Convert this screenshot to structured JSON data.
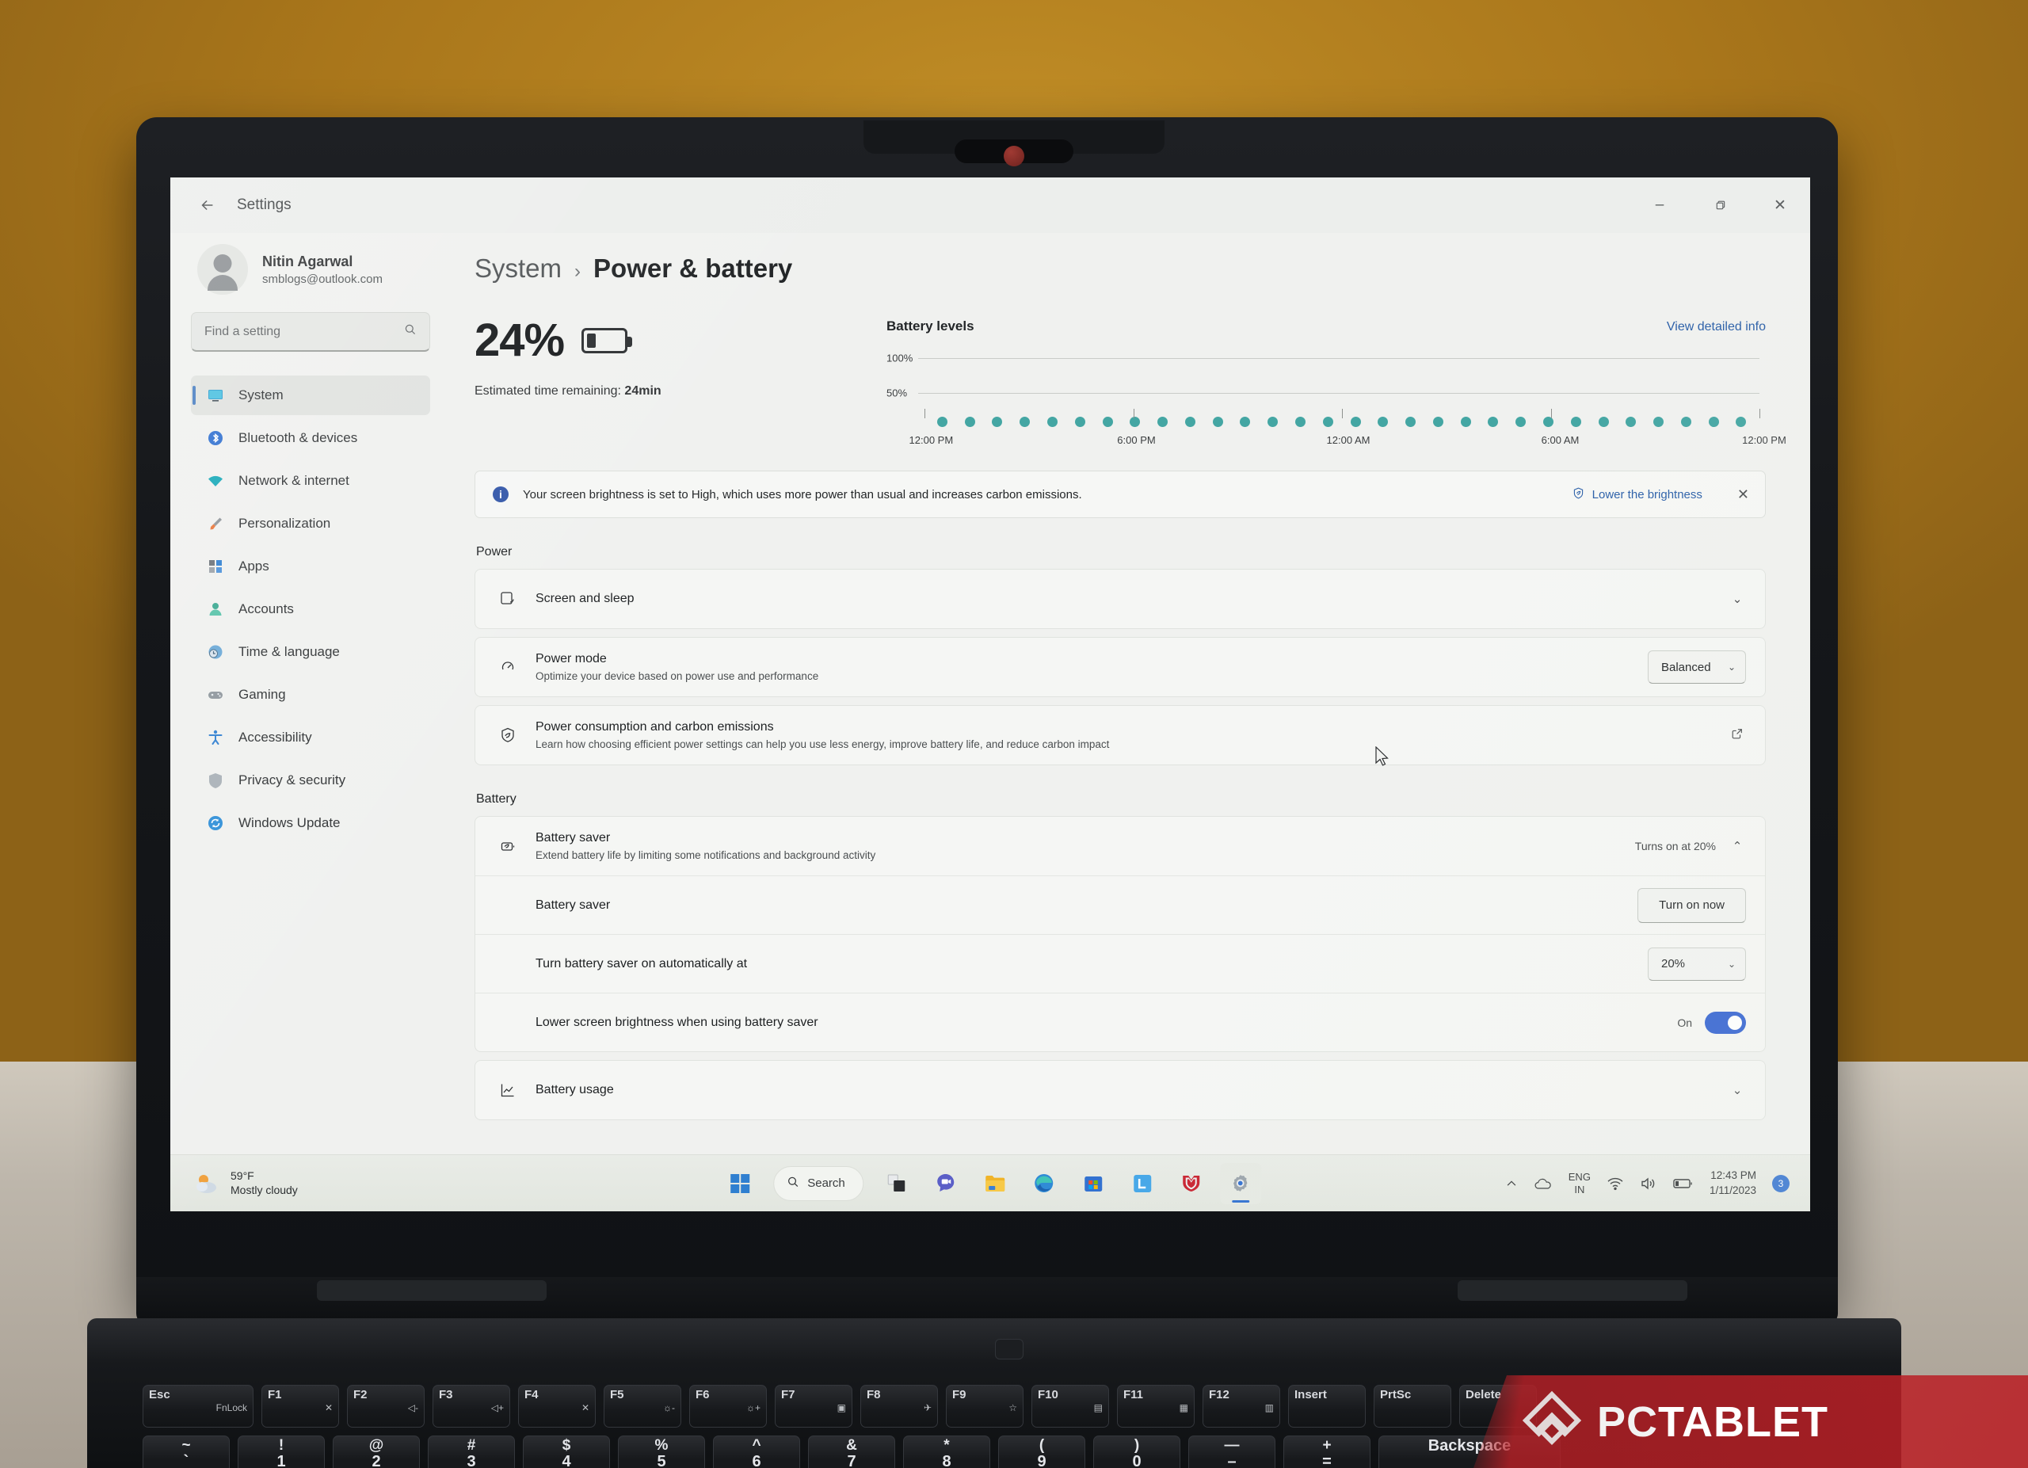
{
  "window": {
    "title": "Settings",
    "back_icon": "back-arrow-icon",
    "minimize": "–",
    "maximize": "❐",
    "close": "✕"
  },
  "account": {
    "name": "Nitin Agarwal",
    "email": "smblogs@outlook.com"
  },
  "search": {
    "placeholder": "Find a setting",
    "icon": "search-icon"
  },
  "sidebar": {
    "items": [
      {
        "label": "System",
        "icon": "monitor-icon",
        "active": true
      },
      {
        "label": "Bluetooth & devices",
        "icon": "bluetooth-icon",
        "active": false
      },
      {
        "label": "Network & internet",
        "icon": "wifi-icon",
        "active": false
      },
      {
        "label": "Personalization",
        "icon": "paintbrush-icon",
        "active": false
      },
      {
        "label": "Apps",
        "icon": "apps-grid-icon",
        "active": false
      },
      {
        "label": "Accounts",
        "icon": "person-icon",
        "active": false
      },
      {
        "label": "Time & language",
        "icon": "clock-globe-icon",
        "active": false
      },
      {
        "label": "Gaming",
        "icon": "gamepad-icon",
        "active": false
      },
      {
        "label": "Accessibility",
        "icon": "accessibility-icon",
        "active": false
      },
      {
        "label": "Privacy & security",
        "icon": "shield-icon",
        "active": false
      },
      {
        "label": "Windows Update",
        "icon": "update-refresh-icon",
        "active": false
      }
    ]
  },
  "breadcrumb": {
    "root": "System",
    "separator": "›",
    "leaf": "Power & battery"
  },
  "battery_summary": {
    "percent": "24%",
    "estimated_label": "Estimated time remaining:",
    "estimated_value": "24min",
    "battery_icon": "battery-low-icon"
  },
  "chart_data": {
    "type": "scatter",
    "title": "Battery levels",
    "link_label": "View detailed info",
    "xlabel": "",
    "ylabel": "",
    "ylim": [
      0,
      100
    ],
    "ytick_labels": [
      "100%",
      "50%"
    ],
    "yticks": [
      100,
      50
    ],
    "grid": true,
    "x_tick_labels": [
      "12:00 PM",
      "6:00 PM",
      "12:00 AM",
      "6:00 AM",
      "12:00 PM"
    ],
    "x_tick_positions": [
      0,
      25,
      50,
      75,
      100
    ],
    "series": [
      {
        "name": "Battery level",
        "color": "#44a6a3",
        "x": [
          1.5,
          4.8,
          8.1,
          11.4,
          14.7,
          18.0,
          21.3,
          24.6,
          27.9,
          31.2,
          34.5,
          37.8,
          41.1,
          44.4,
          47.7,
          51.0,
          54.3,
          57.6,
          60.9,
          64.2,
          67.5,
          70.8,
          74.1,
          77.4,
          80.7,
          84.0,
          87.3,
          90.6,
          93.9,
          97.2
        ],
        "values": [
          4,
          4,
          4,
          4,
          4,
          4,
          4,
          4,
          4,
          4,
          4,
          4,
          4,
          4,
          4,
          4,
          4,
          4,
          4,
          4,
          4,
          4,
          4,
          4,
          4,
          4,
          4,
          4,
          4,
          4
        ]
      }
    ]
  },
  "banner": {
    "icon": "info-icon",
    "text": "Your screen brightness is set to High, which uses more power than usual and increases carbon emissions.",
    "action_icon": "leaf-shield-icon",
    "action_label": "Lower the brightness",
    "close_icon": "close-icon"
  },
  "power_section": {
    "heading": "Power",
    "rows": [
      {
        "icon": "screen-sleep-icon",
        "title": "Screen and sleep",
        "sub": "",
        "control": "chevron",
        "chevron": "⌄"
      },
      {
        "icon": "power-mode-icon",
        "title": "Power mode",
        "sub": "Optimize your device based on power use and performance",
        "control": "combo",
        "combo_value": "Balanced",
        "combo_arrow": "⌄"
      },
      {
        "icon": "leaf-shield-icon",
        "title": "Power consumption and carbon emissions",
        "sub": "Learn how choosing efficient power settings can help you use less energy, improve battery life, and reduce carbon impact",
        "control": "external",
        "external_icon": "open-external-icon"
      }
    ]
  },
  "battery_section": {
    "heading": "Battery",
    "saver_header": {
      "icon": "battery-saver-icon",
      "title": "Battery saver",
      "sub": "Extend battery life by limiting some notifications and background activity",
      "aux": "Turns on at 20%",
      "chevron": "⌃"
    },
    "rows": [
      {
        "title": "Battery saver",
        "control": "button",
        "button_label": "Turn on now"
      },
      {
        "title": "Turn battery saver on automatically at",
        "control": "combo",
        "combo_value": "20%",
        "combo_arrow": "⌄"
      },
      {
        "title": "Lower screen brightness when using battery saver",
        "control": "toggle",
        "toggle_label": "On",
        "toggle_on": true
      }
    ],
    "usage_row": {
      "icon": "chart-line-icon",
      "title": "Battery usage",
      "chevron": "⌄"
    }
  },
  "taskbar": {
    "weather": {
      "icon": "sun-cloud-icon",
      "temperature": "59°F",
      "description": "Mostly cloudy"
    },
    "start_icon": "windows-start-icon",
    "search_label": "Search",
    "search_icon": "search-icon",
    "apps": [
      {
        "name": "task-view-icon"
      },
      {
        "name": "chat-teams-icon"
      },
      {
        "name": "file-explorer-icon"
      },
      {
        "name": "microsoft-edge-icon"
      },
      {
        "name": "microsoft-store-icon"
      },
      {
        "name": "lenovo-vantage-icon"
      },
      {
        "name": "mcafee-icon"
      },
      {
        "name": "settings-gear-icon"
      }
    ],
    "tray": {
      "chevron_icon": "chevron-up-icon",
      "onedrive_icon": "onedrive-cloud-icon",
      "language_line1": "ENG",
      "language_line2": "IN",
      "wifi_icon": "wifi-icon",
      "volume_icon": "speaker-icon",
      "battery_icon": "battery-low-icon",
      "time": "12:43 PM",
      "date": "1/11/2023",
      "notification_count": "3"
    }
  },
  "keyboard": {
    "fn_row": [
      {
        "main": "Esc",
        "sub": "FnLock"
      },
      {
        "main": "F1",
        "sub": "✕︎"
      },
      {
        "main": "F2",
        "sub": "◁-"
      },
      {
        "main": "F3",
        "sub": "◁+"
      },
      {
        "main": "F4",
        "sub": "✕"
      },
      {
        "main": "F5",
        "sub": "☼-"
      },
      {
        "main": "F6",
        "sub": "☼+"
      },
      {
        "main": "F7",
        "sub": "▣"
      },
      {
        "main": "F8",
        "sub": "✈"
      },
      {
        "main": "F9",
        "sub": "☆"
      },
      {
        "main": "F10",
        "sub": "▤"
      },
      {
        "main": "F11",
        "sub": "▦"
      },
      {
        "main": "F12",
        "sub": "▥"
      },
      {
        "main": "Insert",
        "sub": ""
      },
      {
        "main": "PrtSc",
        "sub": ""
      },
      {
        "main": "Delete",
        "sub": ""
      }
    ],
    "num_row": [
      {
        "top": "~",
        "bot": "`"
      },
      {
        "top": "!",
        "bot": "1"
      },
      {
        "top": "@",
        "bot": "2"
      },
      {
        "top": "#",
        "bot": "3"
      },
      {
        "top": "$",
        "bot": "4"
      },
      {
        "top": "%",
        "bot": "5"
      },
      {
        "top": "^",
        "bot": "6"
      },
      {
        "top": "&",
        "bot": "7"
      },
      {
        "top": "*",
        "bot": "8"
      },
      {
        "top": "(",
        "bot": "9"
      },
      {
        "top": ")",
        "bot": "0"
      },
      {
        "top": "—",
        "bot": "–"
      },
      {
        "top": "+",
        "bot": "="
      },
      {
        "top": "",
        "bot": "Backspace"
      }
    ]
  },
  "watermark": {
    "text_pc": "PC",
    "text_tablet": "TABLET",
    "logo_icon": "pctablet-logo-icon"
  },
  "colors": {
    "accent": "#2f6fd0",
    "chart_dot": "#44a6a3",
    "link": "#2b5fa8",
    "backdrop": "#b5811e"
  }
}
